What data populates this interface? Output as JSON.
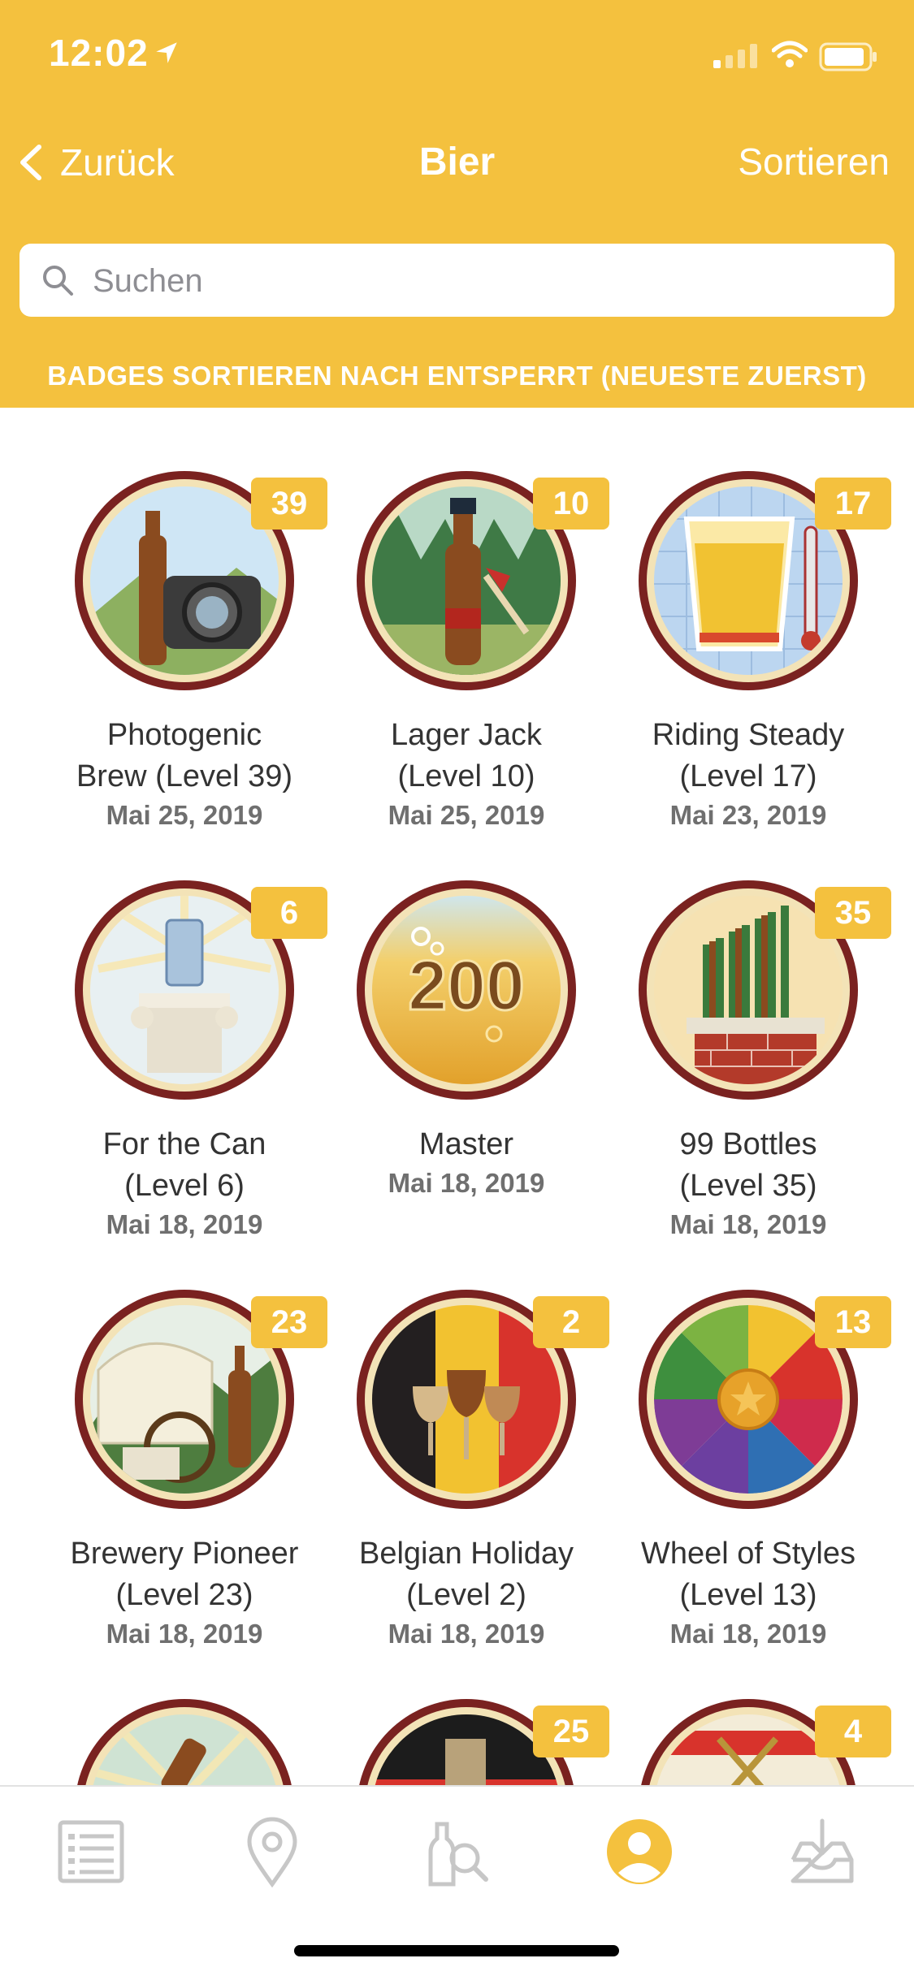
{
  "status_bar": {
    "time": "12:02"
  },
  "nav": {
    "back_label": "Zurück",
    "title": "Bier",
    "sort_label": "Sortieren"
  },
  "search": {
    "placeholder": "Suchen"
  },
  "sort_info": "BADGES SORTIEREN NACH ENTSPERRT (NEUESTE ZUERST)",
  "colors": {
    "header": "#f4c13e",
    "badge_ring": "#7a2220",
    "level_tag": "#f4c13e",
    "active_tab": "#f4c13e",
    "inactive_tab": "#c7c7c7"
  },
  "badges": [
    {
      "name_line1": "Photogenic",
      "name_line2": "Brew (Level 39)",
      "date": "Mai 25, 2019",
      "level": "39",
      "icon": "photogenic-brew-badge-icon"
    },
    {
      "name_line1": "Lager Jack",
      "name_line2": "(Level 10)",
      "date": "Mai 25, 2019",
      "level": "10",
      "icon": "lager-jack-badge-icon"
    },
    {
      "name_line1": "Riding Steady",
      "name_line2": "(Level 17)",
      "date": "Mai 23, 2019",
      "level": "17",
      "icon": "riding-steady-badge-icon"
    },
    {
      "name_line1": "For the Can",
      "name_line2": "(Level 6)",
      "date": "Mai 18, 2019",
      "level": "6",
      "icon": "for-the-can-badge-icon"
    },
    {
      "name_line1": "Master",
      "name_line2": "",
      "date": "Mai 18, 2019",
      "level": "",
      "icon": "master-200-badge-icon",
      "emblem_text": "200"
    },
    {
      "name_line1": "99 Bottles",
      "name_line2": "(Level 35)",
      "date": "Mai 18, 2019",
      "level": "35",
      "icon": "99-bottles-badge-icon"
    },
    {
      "name_line1": "Brewery Pioneer",
      "name_line2": "(Level 23)",
      "date": "Mai 18, 2019",
      "level": "23",
      "icon": "brewery-pioneer-badge-icon"
    },
    {
      "name_line1": "Belgian Holiday",
      "name_line2": "(Level 2)",
      "date": "Mai 18, 2019",
      "level": "2",
      "icon": "belgian-holiday-badge-icon"
    },
    {
      "name_line1": "Wheel of Styles",
      "name_line2": "(Level 13)",
      "date": "Mai 18, 2019",
      "level": "13",
      "icon": "wheel-of-styles-badge-icon"
    },
    {
      "name_line1": "",
      "name_line2": "",
      "date": "",
      "level": "",
      "icon": "partial-badge-icon"
    },
    {
      "name_line1": "",
      "name_line2": "",
      "date": "",
      "level": "25",
      "icon": "partial-badge-icon"
    },
    {
      "name_line1": "",
      "name_line2": "",
      "date": "",
      "level": "4",
      "icon": "partial-badge-icon"
    }
  ],
  "tabs": [
    {
      "icon": "activity-list-icon",
      "active": false
    },
    {
      "icon": "location-pin-icon",
      "active": false
    },
    {
      "icon": "beer-search-icon",
      "active": false
    },
    {
      "icon": "profile-icon",
      "active": true
    },
    {
      "icon": "inbox-icon",
      "active": false
    }
  ]
}
